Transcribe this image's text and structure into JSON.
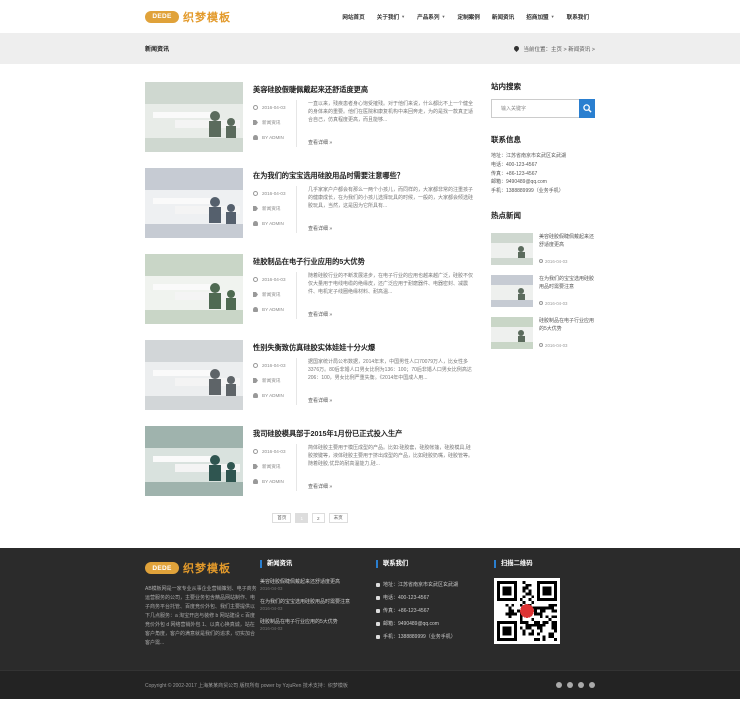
{
  "header": {
    "logo_badge": "DEDE",
    "logo_text": "织梦模板",
    "nav": [
      {
        "label": "网站首页",
        "caret": false
      },
      {
        "label": "关于我们",
        "caret": true
      },
      {
        "label": "产品系列",
        "caret": true
      },
      {
        "label": "定制案例",
        "caret": false
      },
      {
        "label": "新闻资讯",
        "caret": false
      },
      {
        "label": "招商加盟",
        "caret": true
      },
      {
        "label": "联系我们",
        "caret": false
      }
    ]
  },
  "crumb": {
    "title": "新闻资讯",
    "path": "当前位置：主页 > 新闻资讯 >"
  },
  "articles": [
    {
      "title": "美容硅胶假睫佩戴起来还舒适度更高",
      "date": "2016-04-03",
      "category": "新闻资讯",
      "author": "BY ADMIN",
      "excerpt": "一直以来，残疾患者身心饱受摧残。对于他们来说，什么都比不上一个健全的身体来的重要。他们在医院和康复机构中来回奔走，为的是找一款真正适合自己，仿真程度更高，而且能够...",
      "more": "查看详细"
    },
    {
      "title": "在为我们的宝宝选用硅胶用品时需要注意哪些？",
      "date": "2016-04-03",
      "category": "新闻资讯",
      "author": "BY ADMIN",
      "excerpt": "几乎家家户户都会有那么一两个小孩儿，而同样的，大家都非常的注重孩子的健康成长，在为我们的小孩儿选择玩具的时候，一般的，大家都会倾选硅胶玩具，当然，这是因为它所具有...",
      "more": "查看详细"
    },
    {
      "title": "硅胶制品在电子行业应用的5大优势",
      "date": "2016-04-03",
      "category": "新闻资讯",
      "author": "BY ADMIN",
      "excerpt": "随着硅胶行业的不断发展进步，在电子行业的应用也越来越广泛，硅胶不仅仅大量用于电线电缆的绝缘皮，还广泛应用于耐磨器件、电器密封、减震件、电机定子线圈绝缘材料、耐高温...",
      "more": "查看详细"
    },
    {
      "title": "性别失衡致仿真硅胶实体娃娃十分火爆",
      "date": "2016-04-03",
      "category": "新闻资讯",
      "author": "BY ADMIN",
      "excerpt": "据国家统计局公布数据，2014年末，中国男性人口70079万人，比女性多3376万。80后非婚人口男女比例为136：100；70后非婚人口男女比例高达206：100，男女比例严重失衡。《2014年中国成人用...",
      "more": "查看详细"
    },
    {
      "title": "我司硅胶模具部于2015年1月份已正式投入生产",
      "date": "2016-04-03",
      "category": "新闻资讯",
      "author": "BY ADMIN",
      "excerpt": "简体硅胶主要用于模压成型的产品。比如:硅胶套，硅胶帐篷，硅胶模具,硅胶按键等，液体硅胶主要用于挤出成型的产品，比如硅胶奶嘴，硅胶管等。随着硅胶,优异的耐高温能力,硅...",
      "more": "查看详细"
    }
  ],
  "pager": [
    "首页",
    "1",
    "2",
    "末页"
  ],
  "sidebar": {
    "search_title": "站内搜索",
    "search_placeholder": "输入关键字",
    "contact_title": "联系信息",
    "contact": [
      "地址：江苏省南京市玄武区玄武湖",
      "电话：400-123-4567",
      "传真：+86-123-4567",
      "邮箱：9490489@qq.com",
      "手机：1388889999（业务手机）"
    ],
    "hot_title": "热点新闻",
    "hot": [
      {
        "title": "美容硅胶假睫佩戴起来还舒适度更高",
        "date": "2016-04-03"
      },
      {
        "title": "在为我们的宝宝选用硅胶用品时需要注意",
        "date": "2016-04-03"
      },
      {
        "title": "硅胶制品在电子行业应用的5大优势",
        "date": "2016-04-03"
      }
    ]
  },
  "footer": {
    "logo_badge": "DEDE",
    "logo_text": "织梦模板",
    "about": "AB模板网是一家专业从事企业营销策划、电子商务运营服务的公司，主要业务包含精品网站制作、电子商务平台托管、百度竞价外包、我们主要提供以下几点服务：a 淘宝开店与装修 b 网站建设 c 百度竞价外包 d 网络营销外包 1、以真心换真诚，站在客户角度，客户的满意就是我们的追求，切实加合客户需...",
    "news_title": "新闻资讯",
    "news": [
      {
        "title": "美容硅胶假睫佩戴起来还舒适度更高",
        "date": "2016-04-03"
      },
      {
        "title": "在为我们的宝宝选用硅胶用品时需要注意",
        "date": "2016-04-03"
      },
      {
        "title": "硅胶制品在电子行业应用的5大优势",
        "date": "2016-04-03"
      }
    ],
    "contact_title": "联系我们",
    "contact": [
      "地址：江苏省南京市玄武区玄武湖",
      "电话：400-123-4567",
      "传真：+86-123-4567",
      "邮箱：9490489@qq.com",
      "手机：1388889999（业务手机）"
    ],
    "qr_title": "扫描二维码",
    "copyright": "Copyright © 2002-2017 上海某某商贸公司 版权所有 power by YzjuRen 技术支持：织梦模板"
  }
}
